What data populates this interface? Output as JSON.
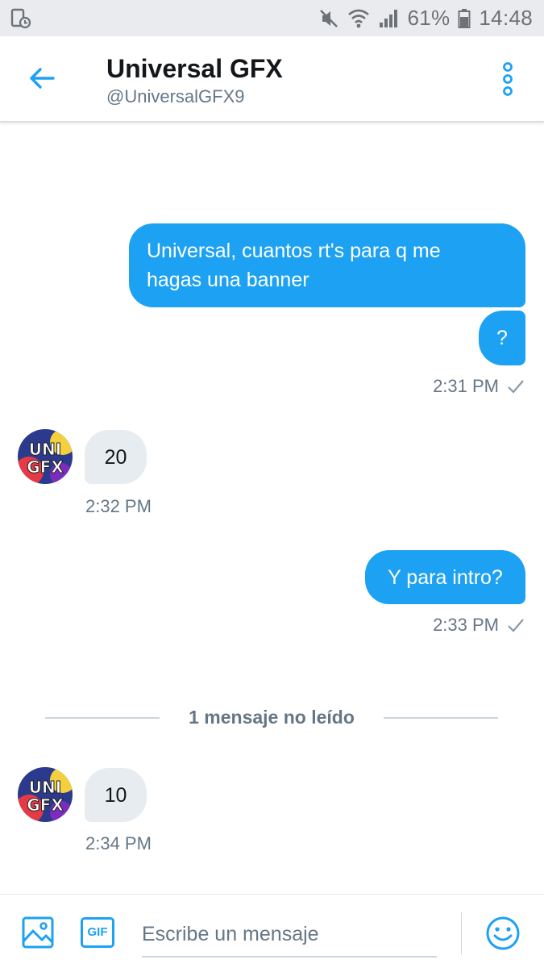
{
  "status_bar": {
    "battery_percent": "61%",
    "time": "14:48",
    "icons": [
      "screenshot-icon",
      "mute-icon",
      "wifi-icon",
      "signal-icon",
      "battery-icon"
    ]
  },
  "header": {
    "title": "Universal GFX",
    "handle": "@UniversalGFX9",
    "icons": [
      "back-arrow-icon",
      "more-options-icon"
    ]
  },
  "messages": [
    {
      "direction": "outgoing",
      "text_lines": [
        "Universal, cuantos rt's para q me",
        "hagas una banner"
      ]
    },
    {
      "direction": "outgoing",
      "text": "?",
      "time": "2:31 PM"
    },
    {
      "direction": "incoming",
      "text": "20",
      "time": "2:32 PM",
      "avatar_text": "UNI GFX"
    },
    {
      "direction": "outgoing",
      "text": "Y para intro?",
      "time": "2:33 PM"
    },
    {
      "direction": "incoming",
      "text": "10",
      "time": "2:34 PM",
      "avatar_text": "UNI GFX"
    }
  ],
  "unread_divider": "1 mensaje no leído",
  "composer": {
    "placeholder": "Escribe un mensaje",
    "value": "",
    "gif_label": "GIF",
    "icons": [
      "image-icon",
      "gif-icon",
      "emoji-icon"
    ]
  },
  "colors": {
    "accent": "#1da1f2",
    "incoming_bubble": "#e6ecf0",
    "secondary_text": "#657786",
    "status_bar_bg": "#e9ebee"
  }
}
